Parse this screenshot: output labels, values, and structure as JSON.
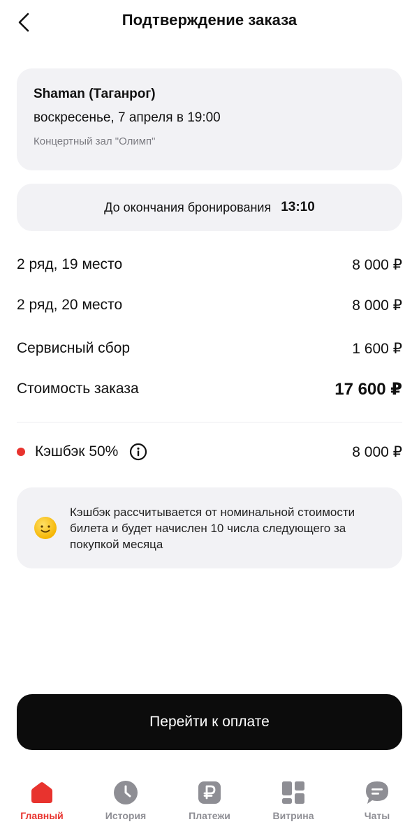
{
  "header": {
    "title": "Подтверждение заказа",
    "back_icon": "chevron-left-icon"
  },
  "event": {
    "name": "Shaman (Таганрог)",
    "date": "воскресенье, 7 апреля в 19:00",
    "venue": "Концертный зал \"Олимп\""
  },
  "booking_timer": {
    "label": "До окончания бронирования",
    "value": "13:10"
  },
  "line_items": [
    {
      "label": "2 ряд, 19 место",
      "amount": "8 000 ₽"
    },
    {
      "label": "2 ряд, 20 место",
      "amount": "8 000 ₽"
    },
    {
      "label": "Сервисный сбор",
      "amount": "1 600 ₽"
    }
  ],
  "total": {
    "label": "Стоимость заказа",
    "amount": "17 600 ₽"
  },
  "cashback": {
    "label": "Кэшбэк 50%",
    "amount": "8 000 ₽",
    "dot_color": "#e8332e"
  },
  "cashback_note": "Кэшбэк рассчитывается от номинальной стоимости билета и будет начислен 10 числа следующего за покупкой месяца",
  "pay_button": {
    "label": "Перейти к оплате"
  },
  "tabbar": {
    "accent_color": "#e8332e",
    "inactive_color": "#8e8e94",
    "tabs": [
      {
        "label": "Главный",
        "icon": "home-icon",
        "active": true
      },
      {
        "label": "История",
        "icon": "clock-icon",
        "active": false
      },
      {
        "label": "Платежи",
        "icon": "ruble-icon",
        "active": false
      },
      {
        "label": "Витрина",
        "icon": "grid-icon",
        "active": false
      },
      {
        "label": "Чаты",
        "icon": "chat-icon",
        "active": false
      }
    ]
  }
}
